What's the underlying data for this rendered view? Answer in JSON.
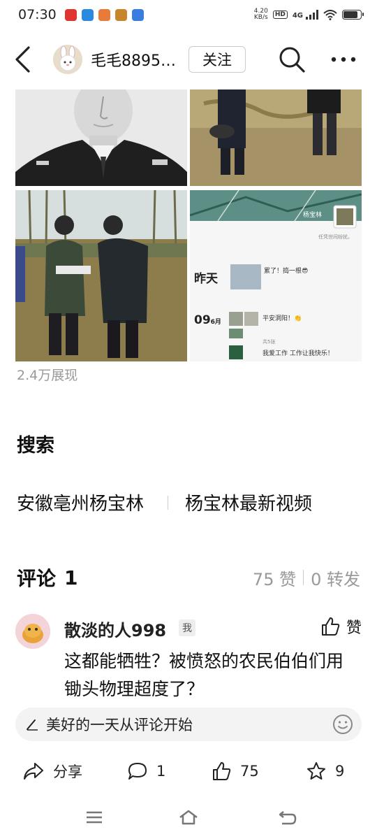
{
  "status_bar": {
    "time": "07:30",
    "net_speed_value": "4.20",
    "net_speed_unit": "KB/s",
    "hd_label": "HD",
    "signal_label": "4G",
    "battery_level": 0.85
  },
  "header": {
    "username": "毛毛8895…",
    "follow_label": "关注"
  },
  "post": {
    "views": "2.4万展现",
    "images": [
      {
        "icon": "portrait-photo"
      },
      {
        "icon": "field-photo"
      },
      {
        "icon": "field-photo"
      },
      {
        "icon": "screenshot-profile"
      }
    ],
    "screenshot": {
      "profile_name": "杨宝林",
      "profile_sub": "任凭世间纷扰。",
      "yesterday_label": "昨天",
      "post1_text": "累了！捣一根😎",
      "date_label": "09",
      "month_label": "6月",
      "post2_text": "平安洞阳！👏",
      "post2_sub": "共5张",
      "post3_text": "我爱工作 工作让我快乐！"
    }
  },
  "search": {
    "title": "搜索",
    "links": [
      "安徽亳州杨宝林",
      "杨宝林最新视频"
    ]
  },
  "comments": {
    "title": "评论",
    "count": "1",
    "likes": "75 赞",
    "reposts": "0 转发",
    "items": [
      {
        "name": "散淡的人998",
        "badge": "我",
        "like_label": "赞",
        "text": "这都能牺牲？被愤怒的农民伯伯们用锄头物理超度了？"
      }
    ]
  },
  "comment_input": {
    "placeholder": "美好的一天从评论开始"
  },
  "actions": {
    "share_label": "分享",
    "comment_count": "1",
    "like_count": "75",
    "favorite_count": "9"
  },
  "colors": {
    "text": "#111111",
    "muted": "#999999",
    "input_bg": "#f3f3f3"
  }
}
